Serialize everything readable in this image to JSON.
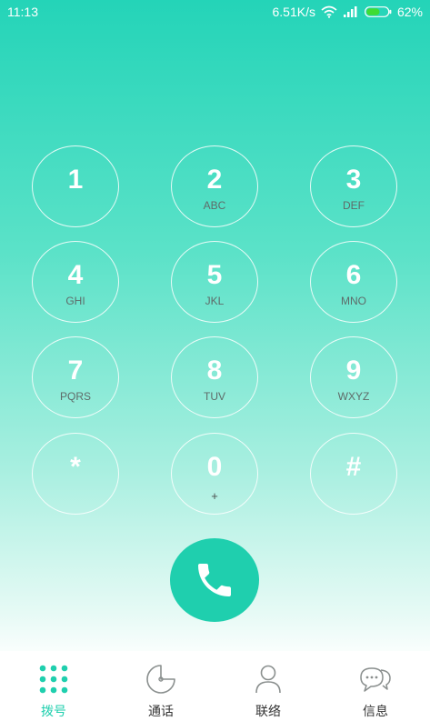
{
  "status_bar": {
    "time": "11:13",
    "net_speed": "6.51K/s",
    "battery_percent": "62%",
    "battery_level": 0.62,
    "icons": [
      "wifi-icon",
      "signal-icon",
      "battery-icon"
    ]
  },
  "dialpad": {
    "keys": [
      {
        "digit": "1",
        "letters": ""
      },
      {
        "digit": "2",
        "letters": "ABC"
      },
      {
        "digit": "3",
        "letters": "DEF"
      },
      {
        "digit": "4",
        "letters": "GHI"
      },
      {
        "digit": "5",
        "letters": "JKL"
      },
      {
        "digit": "6",
        "letters": "MNO"
      },
      {
        "digit": "7",
        "letters": "PQRS"
      },
      {
        "digit": "8",
        "letters": "TUV"
      },
      {
        "digit": "9",
        "letters": "WXYZ"
      },
      {
        "digit": "*",
        "letters": ""
      },
      {
        "digit": "0",
        "letters": "+"
      },
      {
        "digit": "#",
        "letters": ""
      }
    ]
  },
  "call_button": {
    "icon": "phone-icon"
  },
  "bottom_nav": {
    "items": [
      {
        "label": "拨号",
        "icon": "dialpad-icon",
        "active": true
      },
      {
        "label": "通话",
        "icon": "call-log-icon",
        "active": false
      },
      {
        "label": "联络",
        "icon": "contacts-icon",
        "active": false
      },
      {
        "label": "信息",
        "icon": "messages-icon",
        "active": false
      }
    ]
  },
  "colors": {
    "accent": "#1fcfae",
    "gradient_top": "#24d4b8",
    "text_muted": "#5f6b69"
  }
}
